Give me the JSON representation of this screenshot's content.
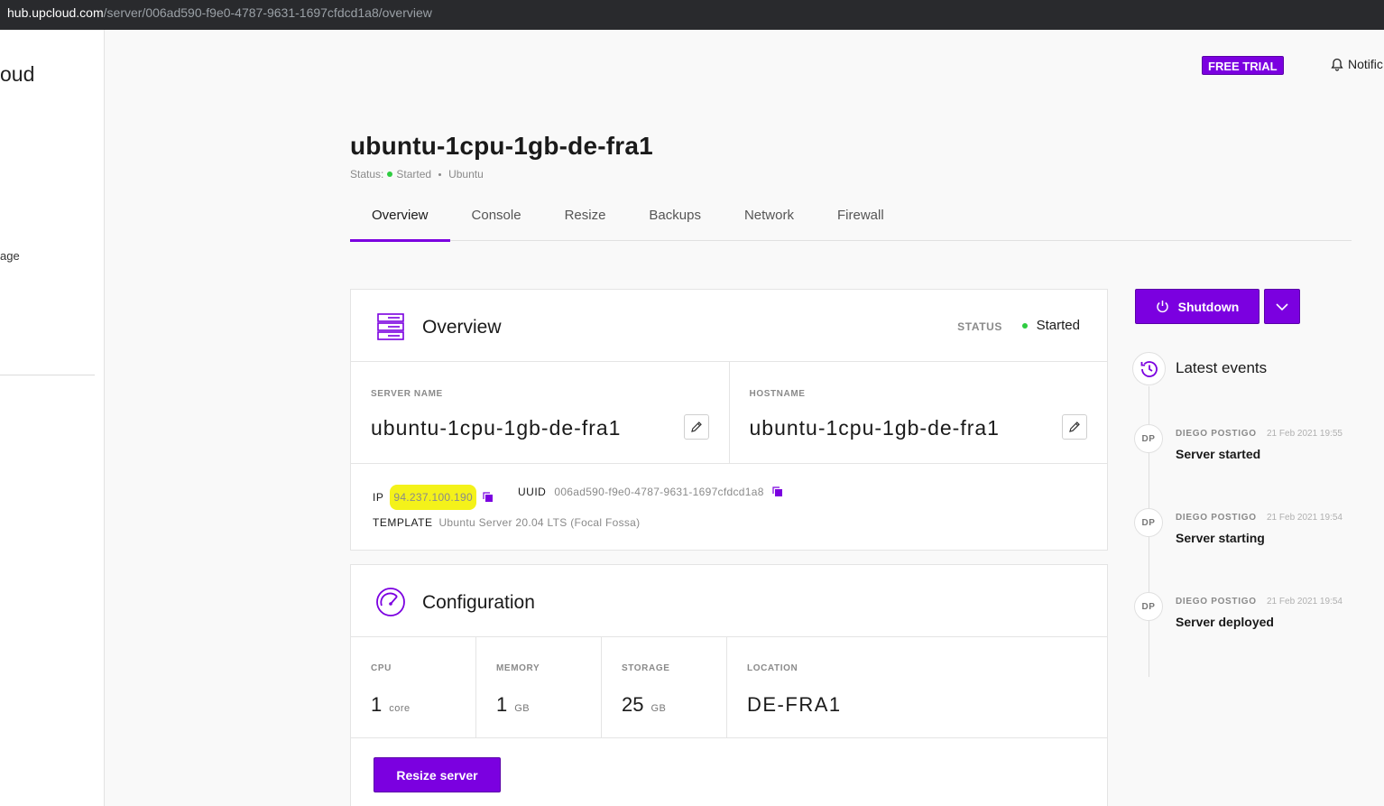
{
  "browser": {
    "url_host": "hub.upcloud.com",
    "url_path": "/server/006ad590-f9e0-4787-9631-1697cfdcd1a8/overview"
  },
  "sidebar": {
    "logo_fragment": "oud",
    "nav_fragment": "age"
  },
  "topbar": {
    "trial_badge": "FREE TRIAL",
    "notifications": "Notific"
  },
  "server": {
    "title": "ubuntu-1cpu-1gb-de-fra1",
    "status_prefix": "Status:",
    "status_text": "Started",
    "os": "Ubuntu"
  },
  "tabs": [
    {
      "label": "Overview",
      "active": true
    },
    {
      "label": "Console"
    },
    {
      "label": "Resize"
    },
    {
      "label": "Backups"
    },
    {
      "label": "Network"
    },
    {
      "label": "Firewall"
    }
  ],
  "overview": {
    "title": "Overview",
    "status_label": "STATUS",
    "status_value": "Started",
    "server_name_label": "SERVER NAME",
    "server_name": "ubuntu-1cpu-1gb-de-fra1",
    "hostname_label": "HOSTNAME",
    "hostname": "ubuntu-1cpu-1gb-de-fra1",
    "ip_label": "IP",
    "ip": "94.237.100.190",
    "uuid_label": "UUID",
    "uuid": "006ad590-f9e0-4787-9631-1697cfdcd1a8",
    "template_label": "TEMPLATE",
    "template": "Ubuntu Server 20.04 LTS (Focal Fossa)"
  },
  "configuration": {
    "title": "Configuration",
    "cpu_label": "CPU",
    "cpu_value": "1",
    "cpu_unit": "core",
    "memory_label": "MEMORY",
    "memory_value": "1",
    "memory_unit": "GB",
    "storage_label": "STORAGE",
    "storage_value": "25",
    "storage_unit": "GB",
    "location_label": "LOCATION",
    "location_value": "DE-FRA1",
    "resize_button": "Resize server"
  },
  "actions": {
    "shutdown_button": "Shutdown"
  },
  "events": {
    "title": "Latest events",
    "items": [
      {
        "initials": "DP",
        "user": "DIEGO POSTIGO",
        "time": "21 Feb 2021 19:55",
        "text": "Server started"
      },
      {
        "initials": "DP",
        "user": "DIEGO POSTIGO",
        "time": "21 Feb 2021 19:54",
        "text": "Server starting"
      },
      {
        "initials": "DP",
        "user": "DIEGO POSTIGO",
        "time": "21 Feb 2021 19:54",
        "text": "Server deployed"
      }
    ]
  },
  "colors": {
    "accent": "#7b00e0",
    "status_green": "#2ecc40",
    "ip_highlight": "#f4f21a"
  }
}
